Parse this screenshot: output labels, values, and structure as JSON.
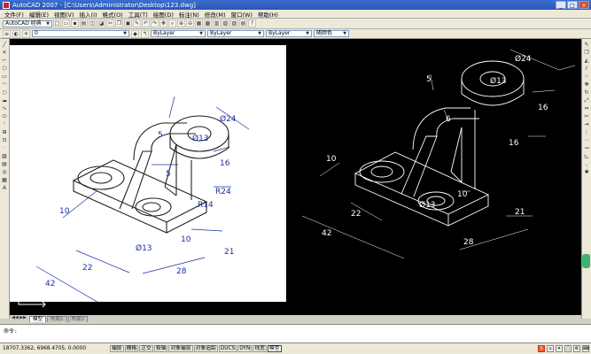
{
  "window": {
    "title": "AutoCAD 2007 - [C:\\Users\\Administrator\\Desktop\\123.dwg]",
    "controls": [
      "_",
      "□",
      "×"
    ]
  },
  "menu": [
    "文件(F)",
    "编辑(E)",
    "视图(V)",
    "插入(I)",
    "格式(O)",
    "工具(T)",
    "绘图(D)",
    "标注(N)",
    "修改(M)",
    "窗口(W)",
    "帮助(H)"
  ],
  "toolbar1": {
    "workspace": "AutoCAD 经典",
    "layer_combo": "0",
    "color_combo": "ByLayer",
    "linetype_combo": "ByLayer",
    "lineweight_combo": "ByLayer",
    "plotstyle_combo": "随颜色"
  },
  "tabs": [
    "模型",
    "布局1",
    "布局2"
  ],
  "command_prompt": "命令:",
  "status": {
    "coords": "18707.3362, 6968.4705, 0.0000",
    "buttons": [
      "捕捉",
      "栅格",
      "正交",
      "极轴",
      "对象捕捉",
      "对象追踪",
      "DUCS",
      "DYN",
      "线宽",
      "模型"
    ]
  },
  "drawing": {
    "white_dims": [
      "Ø24",
      "Ø13",
      "5",
      "16",
      "5",
      "R24",
      "R14",
      "10",
      "10",
      "Ø13",
      "22",
      "42",
      "28",
      "21"
    ],
    "black_dims": [
      "Ø24",
      "Ø13",
      "5",
      "6",
      "16",
      "16",
      "10",
      "10",
      "Ø13",
      "22",
      "42",
      "28",
      "21"
    ]
  },
  "colors": {
    "title_bar": "#2a55b8",
    "canvas_bg": "#000000",
    "dim_blue": "#1a2fa0",
    "line_white": "#ffffff"
  },
  "icons": {
    "left_toolbar": [
      "line-icon",
      "xline-icon",
      "polyline-icon",
      "polygon-icon",
      "rectangle-icon",
      "arc-icon",
      "circle-icon",
      "revcloud-icon",
      "spline-icon",
      "ellipse-icon",
      "ellipse-arc-icon",
      "insert-block-icon",
      "make-block-icon",
      "point-icon",
      "hatch-icon",
      "gradient-icon",
      "region-icon",
      "table-icon",
      "mtext-icon"
    ],
    "right_toolbar": [
      "erase-icon",
      "copy-icon",
      "mirror-icon",
      "offset-icon",
      "array-icon",
      "move-icon",
      "rotate-icon",
      "scale-icon",
      "stretch-icon",
      "trim-icon",
      "extend-icon",
      "break-point-icon",
      "break-icon",
      "join-icon",
      "chamfer-icon",
      "fillet-icon",
      "explode-icon"
    ]
  }
}
